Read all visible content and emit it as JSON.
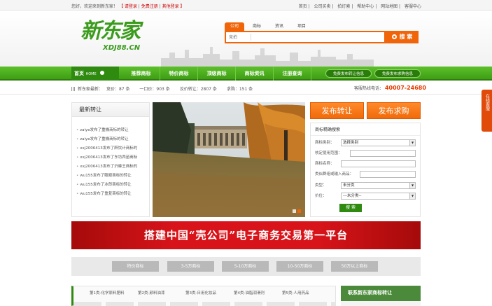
{
  "topbar": {
    "welcome": "您好，欢迎来到新东家！",
    "login": "请登录",
    "register": "免费注册",
    "other_login": "其他登录",
    "links": [
      "首页",
      "公司买卖",
      "拍灯索",
      "帮助中心",
      "网站地图",
      "客服中心"
    ]
  },
  "logo": {
    "cn": "新东家",
    "en": "XDJ88.CN"
  },
  "search": {
    "tabs": [
      "公司",
      "商标",
      "资讯",
      "项目"
    ],
    "placeholder": "竞拍",
    "button": "搜 索"
  },
  "nav": {
    "home": "首页",
    "home_en": "HOME",
    "items": [
      "推荐商标",
      "特价商标",
      "顶级商标",
      "商标资讯",
      "注册查询"
    ],
    "pill_sell": "免费发布转让信息",
    "pill_buy": "免费发布求购信息"
  },
  "ticker": {
    "label": "新东家最新：",
    "stats": [
      "竞价：87 条",
      "一口价：903 条",
      "议价转让：2807 条",
      "求购：151 条"
    ],
    "hotline_label": "客服热线电话：",
    "hotline": "40007-24680"
  },
  "latest": {
    "title": "最新转让",
    "items": [
      "zaiye发布了重機商标的转让",
      "zaiye发布了重機商标的转让",
      "xxj2006413发布了醉饮计商标的",
      "xxj2006413发布了东坊西苗商标",
      "xxj2006413发布了沂蜂王商标的",
      "wu155发布了瞻窥商标的转让",
      "wu155发布了冰郎商标的转让",
      "wu155发布了重复商标的转让"
    ]
  },
  "actions": {
    "sell": "发布转让",
    "buy": "发布求购"
  },
  "filter": {
    "title": "商标精确搜索",
    "category_label": "商标类别：",
    "category_value": "选择类别",
    "scope_label": "核定使用范围：",
    "name_label": "商标名称：",
    "group_label": "类似群组或输入商品：",
    "type_label": "类型：",
    "type_value": "未分类",
    "price_label": "价位：",
    "price_value": "---未分类--",
    "button": "搜 索"
  },
  "banner": {
    "text": "搭建中国“壳公司”电子商务交易第一平台"
  },
  "price_filters": [
    "特价商标",
    "3-5万商标",
    "5-10万商标",
    "10-50万商标",
    "50万以上商标"
  ],
  "categories": [
    "第1类-化学原料肥料",
    "第2类-颜料油漆",
    "第3类-日用化妆品",
    "第4类-油脂润滑剂",
    "第5类-人用药品"
  ],
  "new_transfer": {
    "title": "联系新东家商标转让"
  },
  "side_service": {
    "text": "在线客服"
  }
}
